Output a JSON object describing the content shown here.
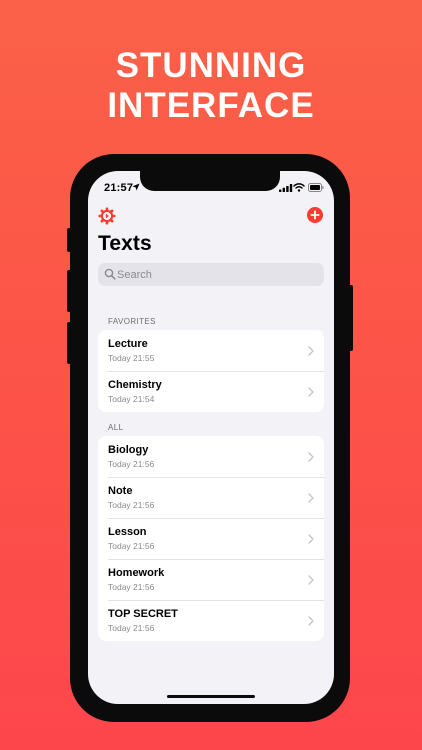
{
  "headline": {
    "line1": "STUNNING",
    "line2": "INTERFACE"
  },
  "status_bar": {
    "time": "21:57",
    "icons": [
      "location-icon",
      "signal-icon",
      "wifi-icon",
      "battery-icon"
    ]
  },
  "toolbar": {
    "settings_icon": "gear-icon",
    "add_icon": "plus-circle-icon"
  },
  "page_title": "Texts",
  "search": {
    "placeholder": "Search",
    "value": ""
  },
  "sections": {
    "favorites": {
      "header": "FAVORITES",
      "items": [
        {
          "title": "Lecture",
          "subtitle": "Today 21:55"
        },
        {
          "title": "Chemistry",
          "subtitle": "Today 21:54"
        }
      ]
    },
    "all": {
      "header": "ALL",
      "items": [
        {
          "title": "Biology",
          "subtitle": "Today 21:56"
        },
        {
          "title": "Note",
          "subtitle": "Today 21:56"
        },
        {
          "title": "Lesson",
          "subtitle": "Today 21:56"
        },
        {
          "title": "Homework",
          "subtitle": "Today 21:56"
        },
        {
          "title": "TOP SECRET",
          "subtitle": "Today 21:56"
        }
      ]
    }
  },
  "colors": {
    "accent": "#ff3b30",
    "background_top": "#fb6148",
    "background_bottom": "#fd464c",
    "screen_background": "#f2f2f7"
  }
}
